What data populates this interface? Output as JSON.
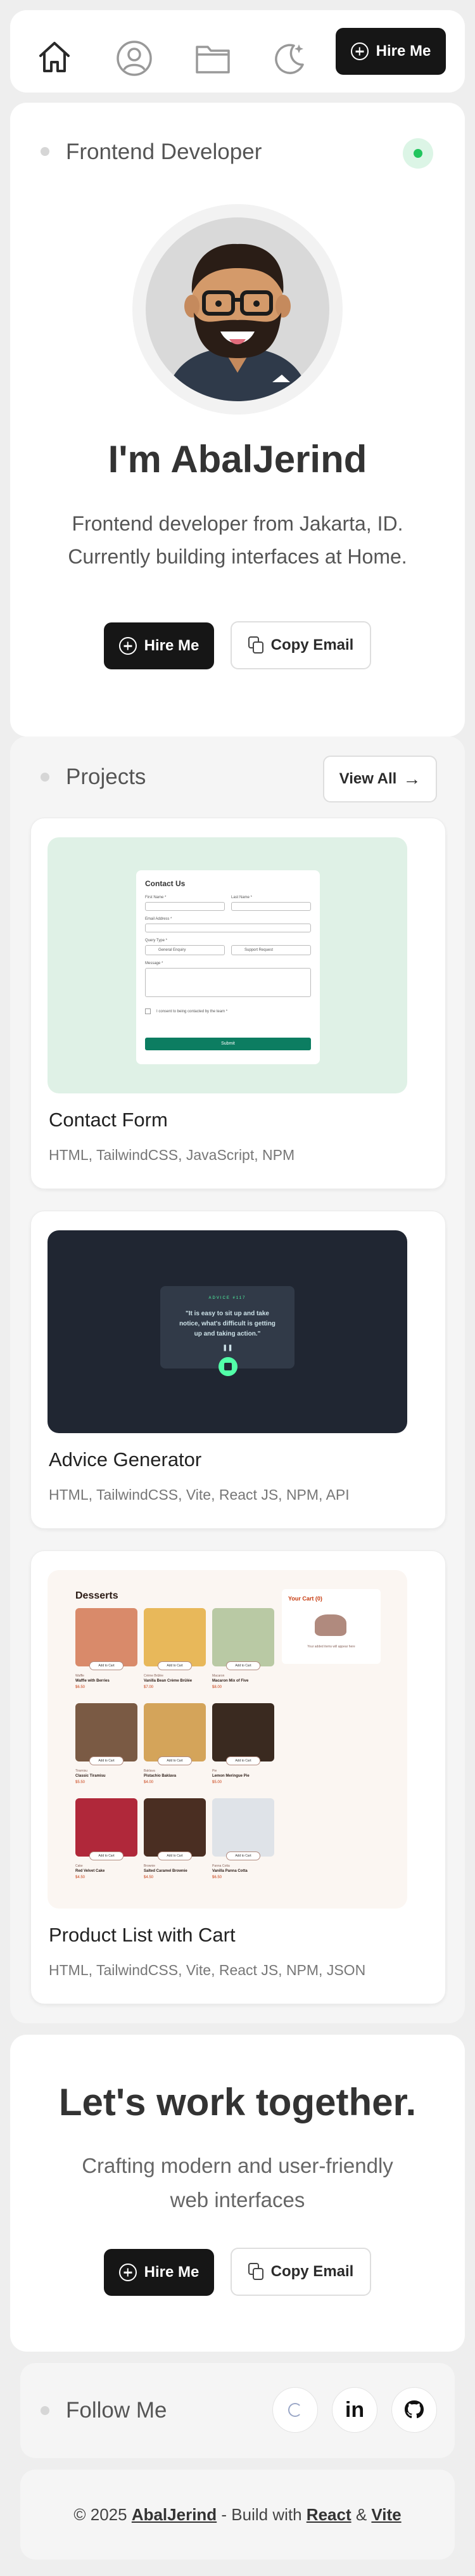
{
  "nav": {
    "hire_label": "Hire Me"
  },
  "hero": {
    "role": "Frontend Developer",
    "heading": "I'm AbalJerind",
    "line1": "Frontend developer from Jakarta, ID.",
    "line2": "Currently building interfaces at Home.",
    "hire_label": "Hire Me",
    "copy_label": "Copy Email",
    "status_color": "#22c55e"
  },
  "projects": {
    "title": "Projects",
    "view_all": "View All",
    "items": [
      {
        "name": "Contact Form",
        "tech": "HTML, TailwindCSS, JavaScript, NPM",
        "preview": {
          "title": "Contact Us",
          "first_name": "First Name *",
          "last_name": "Last Name *",
          "email": "Email Address *",
          "query_type": "Query Type *",
          "opt1": "General Enquiry",
          "opt2": "Support Request",
          "message": "Message *",
          "consent": "I consent to being contacted by the team *",
          "submit": "Submit"
        }
      },
      {
        "name": "Advice Generator",
        "tech": "HTML, TailwindCSS, Vite, React JS, NPM, API",
        "preview": {
          "label": "ADVICE #117",
          "quote1": "\"It is easy to sit up and take",
          "quote2": "notice, what's difficult is getting",
          "quote3": "up and taking action.\""
        }
      },
      {
        "name": "Product List with Cart",
        "tech": "HTML, TailwindCSS, Vite, React JS, NPM, JSON",
        "preview": {
          "title": "Desserts",
          "cart_title": "Your Cart (0)",
          "cart_empty": "Your added items will appear here",
          "add_label": "Add to Cart",
          "products": [
            {
              "cat": "Waffle",
              "name": "Waffle with Berries",
              "price": "$6.50"
            },
            {
              "cat": "Crème Brûlée",
              "name": "Vanilla Bean Crème Brûlée",
              "price": "$7.00"
            },
            {
              "cat": "Macaron",
              "name": "Macaron Mix of Five",
              "price": "$8.00"
            },
            {
              "cat": "Tiramisu",
              "name": "Classic Tiramisu",
              "price": "$5.50"
            },
            {
              "cat": "Baklava",
              "name": "Pistachio Baklava",
              "price": "$4.00"
            },
            {
              "cat": "Pie",
              "name": "Lemon Meringue Pie",
              "price": "$5.00"
            },
            {
              "cat": "Cake",
              "name": "Red Velvet Cake",
              "price": "$4.50"
            },
            {
              "cat": "Brownie",
              "name": "Salted Caramel Brownie",
              "price": "$4.50"
            },
            {
              "cat": "Panna Cotta",
              "name": "Vanilla Panna Cotta",
              "price": "$6.50"
            }
          ]
        }
      }
    ]
  },
  "cta": {
    "heading": "Let's work together.",
    "line1": "Crafting modern and user-friendly",
    "line2": "web interfaces",
    "hire_label": "Hire Me",
    "copy_label": "Copy Email"
  },
  "follow": {
    "title": "Follow Me",
    "linkedin": "in"
  },
  "footer": {
    "prefix": "© 2025 ",
    "name": "AbalJerind",
    "middle": " - Build with ",
    "react": "React",
    "amp": " & ",
    "vite": "Vite"
  }
}
